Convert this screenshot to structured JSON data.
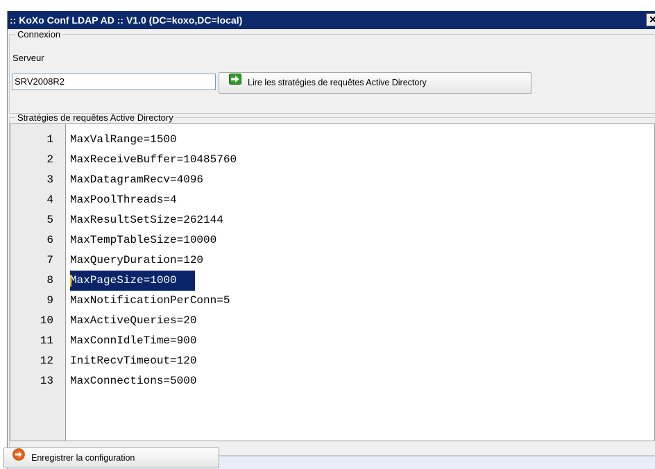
{
  "window": {
    "title": ":: KoXo Conf LDAP AD :: V1.0 (DC=koxo,DC=local)",
    "close_label": "✕"
  },
  "connexion": {
    "legend": "Connexion",
    "server_label": "Serveur",
    "server_value": "SRV2008R2",
    "read_button_label": "Lire les stratégies de requêtes Active Directory",
    "read_button_icon": "green-arrow-right-icon"
  },
  "strategies": {
    "legend": "Stratégies de requêtes Active Directory",
    "selected_line": 8,
    "lines": [
      {
        "num": "1",
        "text": "MaxValRange=1500"
      },
      {
        "num": "2",
        "text": "MaxReceiveBuffer=10485760"
      },
      {
        "num": "3",
        "text": "MaxDatagramRecv=4096"
      },
      {
        "num": "4",
        "text": "MaxPoolThreads=4"
      },
      {
        "num": "5",
        "text": "MaxResultSetSize=262144"
      },
      {
        "num": "6",
        "text": "MaxTempTableSize=10000"
      },
      {
        "num": "7",
        "text": "MaxQueryDuration=120"
      },
      {
        "num": "8",
        "text": "MaxPageSize=1000"
      },
      {
        "num": "9",
        "text": "MaxNotificationPerConn=5"
      },
      {
        "num": "10",
        "text": "MaxActiveQueries=20"
      },
      {
        "num": "11",
        "text": "MaxConnIdleTime=900"
      },
      {
        "num": "12",
        "text": "InitRecvTimeout=120"
      },
      {
        "num": "13",
        "text": "MaxConnections=5000"
      }
    ]
  },
  "footer": {
    "save_button_label": "Enregistrer la configuration",
    "save_button_icon": "orange-arrow-circle-icon"
  },
  "colors": {
    "titlebar": "#0c2a6b",
    "selection": "#0a246a",
    "read_icon": "#2f9a2a",
    "save_icon": "#e8641a"
  }
}
